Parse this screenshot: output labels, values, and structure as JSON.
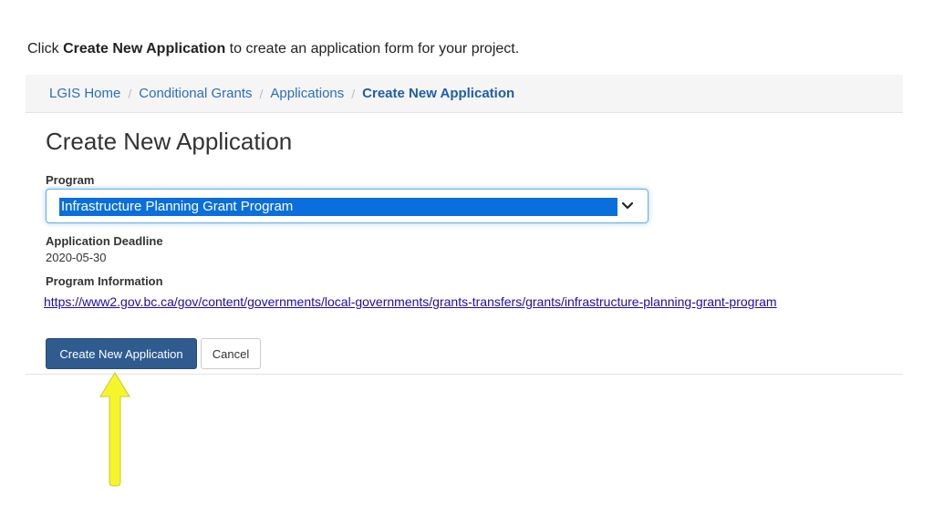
{
  "instruction": {
    "prefix": "Click ",
    "bold": "Create New Application",
    "suffix": " to create an application form for your project."
  },
  "breadcrumb": {
    "items": [
      "LGIS Home",
      "Conditional Grants",
      "Applications",
      "Create New Application"
    ],
    "separator": "/"
  },
  "page": {
    "title": "Create New Application"
  },
  "program": {
    "label": "Program",
    "selected": "Infrastructure Planning Grant Program"
  },
  "deadline": {
    "label": "Application Deadline",
    "value": "2020-05-30"
  },
  "program_info": {
    "label": "Program Information",
    "link": "https://www2.gov.bc.ca/gov/content/governments/local-governments/grants-transfers/grants/infrastructure-planning-grant-program"
  },
  "actions": {
    "create_label": "Create New Application",
    "cancel_label": "Cancel"
  },
  "colors": {
    "primary_button": "#2f5b8e",
    "link": "#2a6ebd",
    "selection": "#0a6fdc",
    "arrow": "#f5f52a"
  },
  "icons": {
    "dropdown": "chevron-down-icon",
    "annotation": "up-arrow-icon"
  }
}
